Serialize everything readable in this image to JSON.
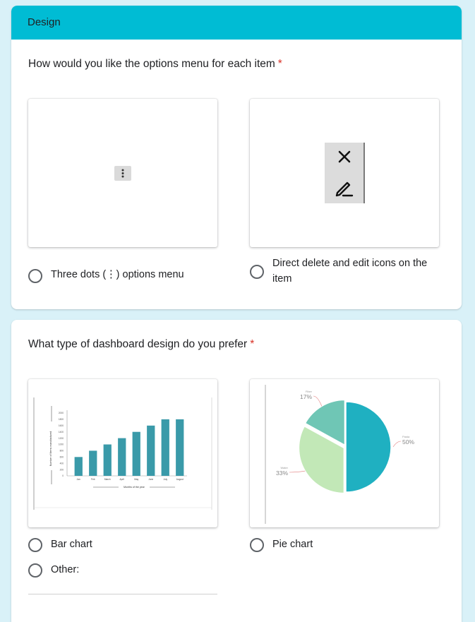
{
  "section": {
    "title": "Design"
  },
  "q1": {
    "text": "How would you like the options menu for each item",
    "required_mark": "*",
    "options": [
      {
        "label": "Three dots (⋮) options menu",
        "icon": "vertical-dots-icon"
      },
      {
        "label": "Direct delete and edit icons on the item",
        "icons": [
          "close-icon",
          "pencil-icon"
        ]
      }
    ]
  },
  "q2": {
    "text": "What type of dashboard design do you prefer",
    "required_mark": "*",
    "options": [
      {
        "label": "Bar chart"
      },
      {
        "label": "Pie chart"
      },
      {
        "label": "Other:"
      }
    ]
  },
  "colors": {
    "header": "#00bcd4",
    "background": "#d9f1f8",
    "required": "#d93025",
    "bar": "#3a9aa9",
    "pie": [
      "#1fb0c1",
      "#c2e8b7",
      "#6fc6b5"
    ]
  },
  "chart_data": [
    {
      "type": "bar",
      "categories": [
        "Jan",
        "Feb",
        "March",
        "April",
        "May",
        "June",
        "July",
        "August"
      ],
      "values": [
        600,
        800,
        1000,
        1200,
        1400,
        1600,
        1800,
        1800
      ],
      "ylim": [
        0,
        2000
      ],
      "yticks": [
        0,
        200,
        400,
        600,
        800,
        1000,
        1200,
        1400,
        1600,
        1800,
        2000
      ],
      "xlabel": "Months of the year",
      "ylabel": "Number of Items manufactured"
    },
    {
      "type": "pie",
      "slices": [
        {
          "name": "Pasta",
          "value": 50,
          "label": "50%"
        },
        {
          "name": "Water",
          "value": 33,
          "label": "33%"
        },
        {
          "name": "Fiber",
          "value": 17,
          "label": "17%"
        }
      ]
    }
  ]
}
